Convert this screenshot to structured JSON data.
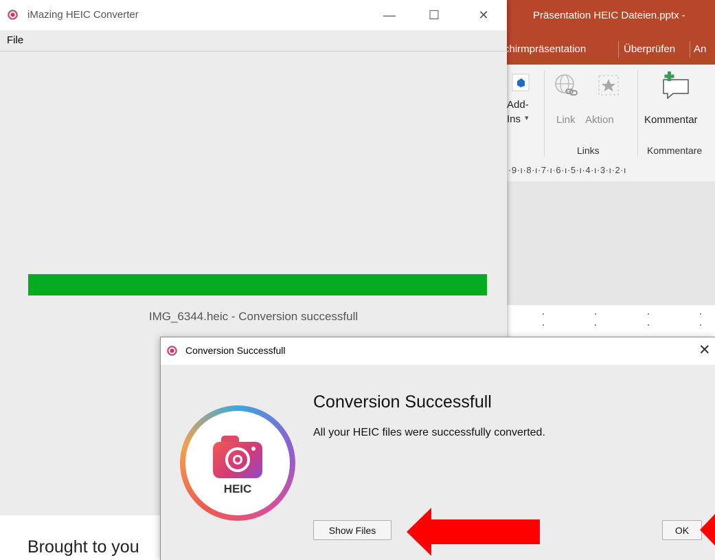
{
  "powerpoint": {
    "window_title": "Präsentation HEIC Dateien.pptx  -",
    "tabs": [
      "chirmpräsentation",
      "Überprüfen",
      "An"
    ],
    "ribbon": {
      "addins_label_line1": "Add-",
      "addins_label_line2": "Ins",
      "addins_dropdown": "▾",
      "link_label": "Link",
      "action_label": "Aktion",
      "comment_label": "Kommentar",
      "group_links": "Links",
      "group_comments": "Kommentare"
    },
    "ruler_text": "·9·ı·8·ı·7·ı·6·ı·5·ı·4·ı·3·ı·2·ı",
    "accent_color": "#b7472a"
  },
  "main_window": {
    "title": "iMazing HEIC Converter",
    "controls": {
      "minimize": "—",
      "maximize": "☐",
      "close": "✕"
    },
    "menu": {
      "file": "File"
    },
    "progress": {
      "fraction": 1.0,
      "color": "#06ab22"
    },
    "status": "IMG_6344.heic - Conversion successfull",
    "footer_text": "Brought to you"
  },
  "dialog": {
    "title": "Conversion Successfull",
    "close_glyph": "✕",
    "heading": "Conversion Successfull",
    "message": "All your HEIC files were successfully converted.",
    "logo_text": "HEIC",
    "buttons": {
      "show_files": "Show Files",
      "ok": "OK"
    }
  },
  "annotations": {
    "arrow_color": "#ff0000"
  }
}
